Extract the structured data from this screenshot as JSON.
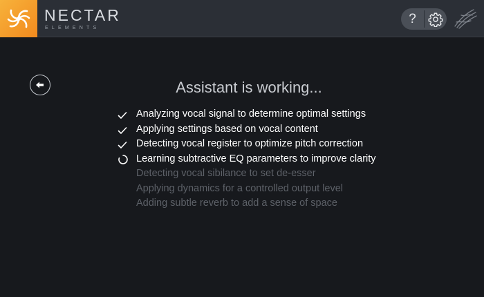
{
  "header": {
    "brand_name": "NECTAR",
    "brand_sub": "ELEMENTS",
    "help_label": "?"
  },
  "main": {
    "title": "Assistant is working...",
    "steps": [
      {
        "label": "Analyzing vocal signal to determine optimal settings",
        "status": "done"
      },
      {
        "label": "Applying settings based on vocal content",
        "status": "done"
      },
      {
        "label": "Detecting vocal register to optimize pitch correction",
        "status": "done"
      },
      {
        "label": "Learning subtractive EQ parameters to improve clarity",
        "status": "active"
      },
      {
        "label": "Detecting vocal sibilance to set de-esser",
        "status": "pending"
      },
      {
        "label": "Applying dynamics for a controlled output level",
        "status": "pending"
      },
      {
        "label": "Adding subtle reverb to add a sense of space",
        "status": "pending"
      }
    ]
  },
  "icons": {
    "logo": "nectar-swirl-logo-icon",
    "help": "question-mark-icon",
    "settings": "gear-icon",
    "link": "scribble-link-icon",
    "back": "back-arrow-icon",
    "done": "checkmark-icon",
    "active": "spinner-icon"
  },
  "colors": {
    "background": "#17191d",
    "header": "#2b2f36",
    "accent": "#f5a02a",
    "text_active": "#ffffff",
    "text_pending": "#5d6168"
  }
}
